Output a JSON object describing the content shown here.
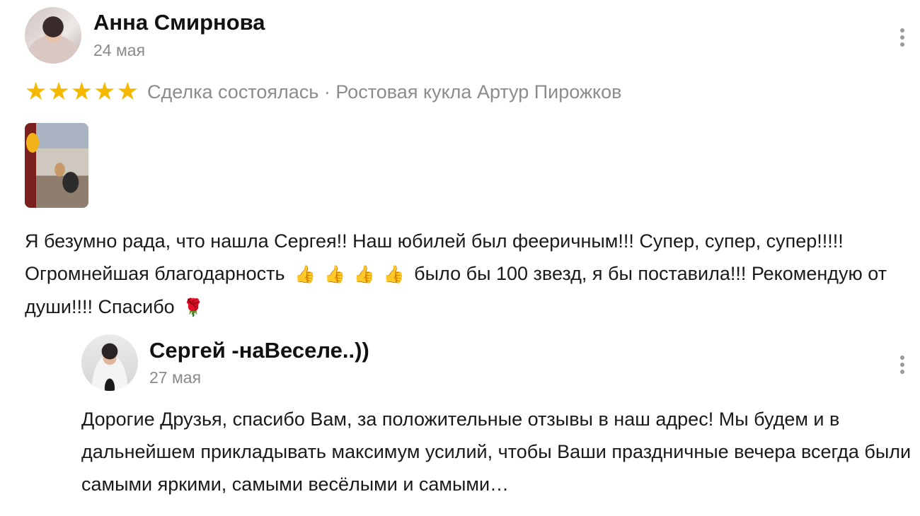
{
  "review": {
    "author": "Анна Смирнова",
    "date": "24 мая",
    "rating": 5,
    "deal_text": "Сделка состоялась · Ростовая кукла Артур Пирожков",
    "text_part1": "Я безумно рада, что нашла Сергея!! Наш юбилей был фееричным!!! Супер, супер, супер!!!!! Огромнейшая благодарность ",
    "text_part2": " было бы 100 звезд, я бы поставила!!! Рекомендую от души!!!! Спасибо ",
    "thumbs": [
      "👍",
      "👍",
      "👍",
      "👍"
    ],
    "rose": "🌹"
  },
  "reply": {
    "author": "Сергей -наВеселе..))",
    "date": "27 мая",
    "text": "Дорогие Друзья, спасибо Вам, за положительные отзывы в наш адрес! Мы будем и в дальнейшем прикладывать максимум усилий, чтобы Ваши праздничные вечера всегда были самыми яркими, самыми весёлыми и самыми…"
  },
  "icons": {
    "star": "★",
    "more": "more-vertical-icon"
  },
  "colors": {
    "star": "#f5b800",
    "muted": "#8c8c8c",
    "text": "#1a1a1a"
  }
}
